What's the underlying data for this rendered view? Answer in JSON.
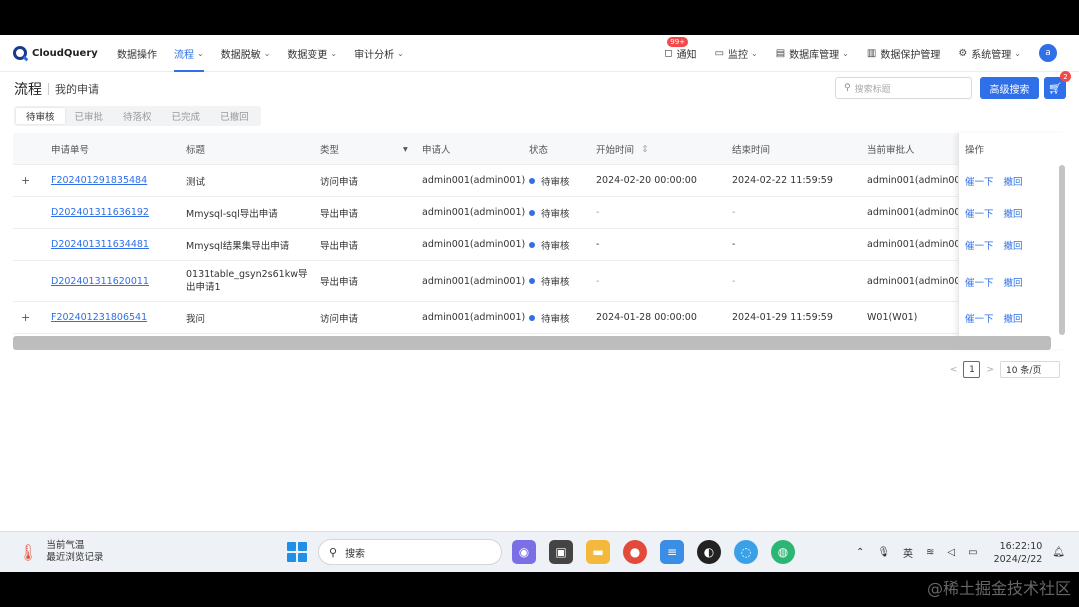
{
  "app": {
    "name": "CloudQuery"
  },
  "nav": [
    "数据操作",
    "流程",
    "数据脱敏",
    "数据变更",
    "审计分析"
  ],
  "right_nav": {
    "notice": "通知",
    "notice_badge": "99+",
    "monitor": "监控",
    "db_manage": "数据库管理",
    "data_protect": "数据保护管理",
    "sys_manage": "系统管理",
    "avatar": "a"
  },
  "page": {
    "title": "流程",
    "subtitle": "我的申请",
    "search_placeholder": "搜索标题",
    "advanced_search": "高级搜索",
    "cart_badge": "2"
  },
  "tabs": [
    "待审核",
    "已审批",
    "待落权",
    "已完成",
    "已撤回"
  ],
  "table": {
    "columns": [
      "申请单号",
      "标题",
      "类型",
      "申请人",
      "状态",
      "开始时间",
      "结束时间",
      "当前审批人",
      "操作"
    ],
    "rows": [
      {
        "expand": "+",
        "id": "F202401291835484",
        "title": "测试",
        "type": "访问申请",
        "applicant": "admin001(admin001)",
        "status": "待审核",
        "start": "2024-02-20 00:00:00",
        "end": "2024-02-22 11:59:59",
        "approver": "admin001(admin001",
        "act1": "催一下",
        "act2": "撤回"
      },
      {
        "expand": "",
        "id": "D202401311636192",
        "title": "Mmysql-sql导出申请",
        "type": "导出申请",
        "applicant": "admin001(admin001)",
        "status": "待审核",
        "start": "-",
        "end": "-",
        "approver": "admin001(admin001",
        "act1": "催一下",
        "act2": "撤回"
      },
      {
        "expand": "",
        "id": "D202401311634481",
        "title": "Mmysql结果集导出申请",
        "type": "导出申请",
        "applicant": "admin001(admin001)",
        "status": "待审核",
        "start": "-",
        "end": "-",
        "approver": "admin001(admin001",
        "act1": "催一下",
        "act2": "撤回"
      },
      {
        "expand": "",
        "id": "D202401311620011",
        "title": "0131table_gsyn2s61kw导出申请1",
        "type": "导出申请",
        "applicant": "admin001(admin001)",
        "status": "待审核",
        "start": "-",
        "end": "-",
        "approver": "admin001(admin001",
        "act1": "催一下",
        "act2": "撤回"
      },
      {
        "expand": "+",
        "id": "F202401231806541",
        "title": "我问",
        "type": "访问申请",
        "applicant": "admin001(admin001)",
        "status": "待审核",
        "start": "2024-01-28 00:00:00",
        "end": "2024-01-29 11:59:59",
        "approver": "W01(W01)",
        "act1": "催一下",
        "act2": "撤回"
      }
    ]
  },
  "pager": {
    "prev": "<",
    "current": "1",
    "next": ">",
    "size": "10 条/页"
  },
  "taskbar": {
    "weather_line1": "当前气温",
    "weather_line2": "最近浏览记录",
    "search": "搜索",
    "ime": "英",
    "time": "16:22:10",
    "date": "2024/2/22"
  },
  "watermark": "@稀土掘金技术社区"
}
